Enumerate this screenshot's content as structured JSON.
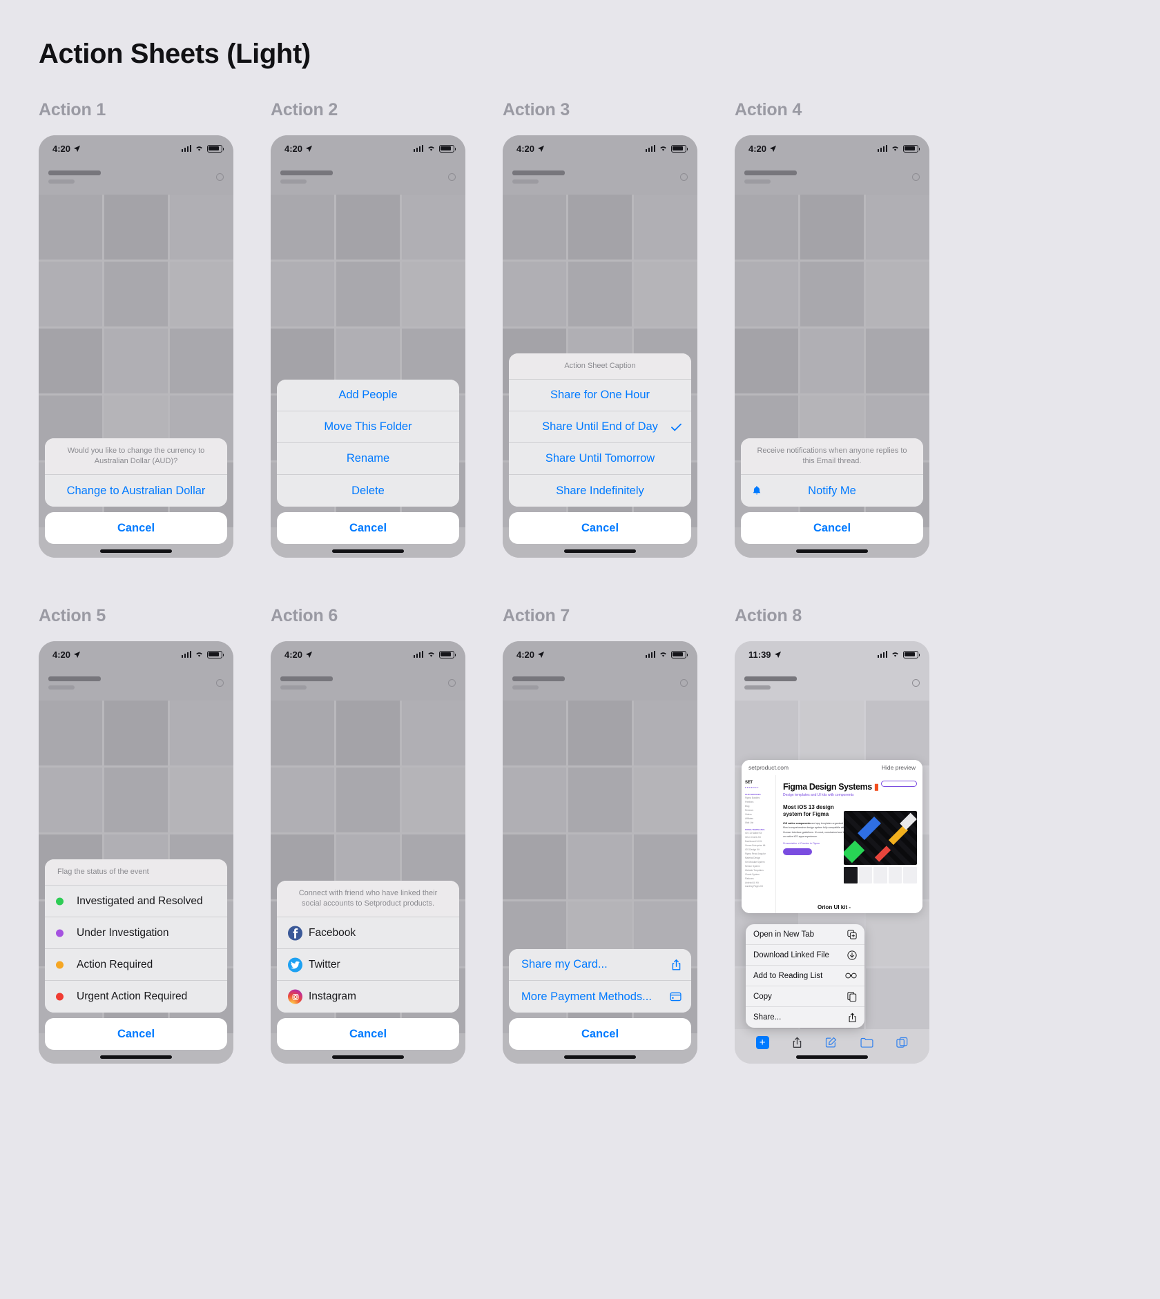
{
  "page_title": "Action Sheets (Light)",
  "status_bar": {
    "time_default": "4:20",
    "time_action8": "11:39"
  },
  "cancel_label": "Cancel",
  "cards": [
    {
      "title": "Action 1",
      "time": "4:20",
      "caption": "Would you like to change the currency to Australian Dollar (AUD)?",
      "items": [
        {
          "label": "Change to Australian Dollar"
        }
      ]
    },
    {
      "title": "Action 2",
      "time": "4:20",
      "caption": null,
      "items": [
        {
          "label": "Add People"
        },
        {
          "label": "Move This Folder"
        },
        {
          "label": "Rename"
        },
        {
          "label": "Delete"
        }
      ]
    },
    {
      "title": "Action 3",
      "time": "4:20",
      "caption": "Action Sheet Caption",
      "items": [
        {
          "label": "Share for One Hour",
          "checked": false
        },
        {
          "label": "Share Until End of Day",
          "checked": true
        },
        {
          "label": "Share Until Tomorrow",
          "checked": false
        },
        {
          "label": "Share Indefinitely",
          "checked": false
        }
      ]
    },
    {
      "title": "Action 4",
      "time": "4:20",
      "caption": "Receive notifications when anyone replies to this Email thread.",
      "items": [
        {
          "label": "Notify Me",
          "icon": "bell-icon"
        }
      ]
    },
    {
      "title": "Action 5",
      "time": "4:20",
      "caption": "Flag the status of the event",
      "items": [
        {
          "label": "Investigated and Resolved",
          "dot_color": "#2ecc55"
        },
        {
          "label": "Under Investigation",
          "dot_color": "#a552e0"
        },
        {
          "label": "Action Required",
          "dot_color": "#f5a623"
        },
        {
          "label": "Urgent Action Required",
          "dot_color": "#f03c33"
        }
      ]
    },
    {
      "title": "Action 6",
      "time": "4:20",
      "caption": "Connect with friend who have linked their social accounts to Setproduct products.",
      "items": [
        {
          "label": "Facebook",
          "icon": "facebook-icon"
        },
        {
          "label": "Twitter",
          "icon": "twitter-icon"
        },
        {
          "label": "Instagram",
          "icon": "instagram-icon"
        }
      ]
    },
    {
      "title": "Action 7",
      "time": "4:20",
      "caption": null,
      "items": [
        {
          "label": "Share my Card...",
          "trail_icon": "share-icon"
        },
        {
          "label": "More Payment Methods...",
          "trail_icon": "credit-card-icon"
        }
      ]
    },
    {
      "title": "Action 8",
      "time": "11:39",
      "preview": {
        "domain": "setproduct.com",
        "hide_label": "Hide preview",
        "logo": "SET",
        "logo_sub": "PRODUCT",
        "nav_heading_1": "OUR SERVICES",
        "nav_items_1": [
          "Figma Bundles",
          "Freebies",
          "Blog",
          "Reviews",
          "Videos",
          "Affiliates",
          "Wait List"
        ],
        "nav_heading_2": "FIGMA TEMPLATES",
        "nav_items_2": [
          "iOS 13 Native Kit",
          "Orion Charts Kit",
          "Dashboard UI Kit",
          "Ocean Enterprise Kit",
          "iOS Design Kit",
          "Figma React Angular",
          "Material Design",
          "Siri Modular System",
          "Nexton System",
          "Website Templates",
          "Charts System",
          "Flaticons",
          "Android UI Kit",
          "Landing Pages Kit"
        ],
        "headline": "Figma Design Systems",
        "subhead": "Design templates and UI kits with components",
        "section_title": "Most iOS 13 design system for Figma",
        "body_bold": "iOS native components",
        "body_text": " and app templates organized into a Most comprehensive design system fully compatible with Human Interface guidelines. It's neat, constrained and based on native iOS apps experience.",
        "links": "Presentation  ✦  Preview in Figma",
        "cta": "Get started",
        "footer_title": "Orion UI kit -"
      },
      "context_menu": [
        {
          "label": "Open in New Tab",
          "icon": "new-tab-icon"
        },
        {
          "label": "Download Linked File",
          "icon": "download-icon"
        },
        {
          "label": "Add to Reading List",
          "icon": "glasses-icon"
        },
        {
          "label": "Copy",
          "icon": "copy-icon"
        },
        {
          "label": "Share...",
          "icon": "share-icon"
        }
      ],
      "toolbar": [
        {
          "icon": "plus-icon"
        },
        {
          "icon": "share-icon"
        },
        {
          "icon": "compose-icon"
        },
        {
          "icon": "bookmarks-icon"
        },
        {
          "icon": "tabs-icon"
        }
      ]
    }
  ],
  "colors": {
    "accent": "#007aff",
    "bg": "#e7e6eb",
    "sheet": "#eaeaec",
    "title": "#9a9aa3"
  }
}
